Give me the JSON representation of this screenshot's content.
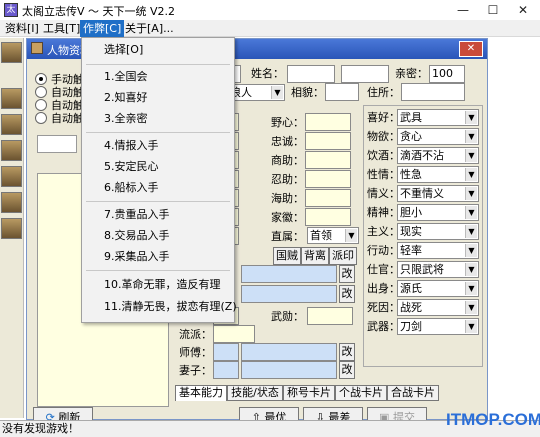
{
  "window": {
    "title": "太阁立志传V ～ 天下一统 V2.2",
    "controls": [
      "—",
      "☐",
      "✕"
    ]
  },
  "menubar": [
    "资料[I]",
    "工具[T]",
    "作弊[C]",
    "关于[A]..."
  ],
  "inner_window": {
    "title": "人物资料"
  },
  "dropdown": {
    "items": [
      {
        "label": "选择[O]"
      },
      {
        "label": "1.全国会"
      },
      {
        "label": "2.知喜好"
      },
      {
        "label": "3.全亲密"
      },
      {
        "label": "4.情报入手"
      },
      {
        "label": "5.安定民心"
      },
      {
        "label": "6.船标入手"
      },
      {
        "label": "7.贵重品入手"
      },
      {
        "label": "8.交易品入手"
      },
      {
        "label": "9.采集品入手"
      },
      {
        "label": "10.革命无罪，造反有理"
      },
      {
        "label": "11.清静无畏，拔恋有理(Z)"
      }
    ]
  },
  "radios": [
    "手动触",
    "自动触",
    "自动触",
    "自动触"
  ],
  "top_row": {
    "name_label": "姓名：",
    "affinity_label": "亲密：",
    "affinity_value": "100",
    "combo1": "浪人",
    "rank_label": "相貌：",
    "residence_label": "住所："
  },
  "stats": [
    "野心：",
    "忠诚：",
    "商助：",
    "忍助：",
    "海助：",
    "家徽："
  ],
  "direct_label": "直属：",
  "direct_value": "首领",
  "mid_buttons": [
    "国贼",
    "背离",
    "派印"
  ],
  "change_label": "改",
  "martial_label": "武勋：",
  "faction_label": "流派：",
  "master_label": "师傅：",
  "spouse_label": "妻子：",
  "right_props": [
    {
      "label": "喜好：",
      "value": "武具"
    },
    {
      "label": "物欲：",
      "value": "贪心"
    },
    {
      "label": "饮酒：",
      "value": "滴酒不沾"
    },
    {
      "label": "性情：",
      "value": "性急"
    },
    {
      "label": "情义：",
      "value": "不重情义"
    },
    {
      "label": "精神：",
      "value": "胆小"
    },
    {
      "label": "主义：",
      "value": "现实"
    },
    {
      "label": "行动：",
      "value": "轻率"
    },
    {
      "label": "仕官：",
      "value": "只限武将"
    },
    {
      "label": "出身：",
      "value": "源氏"
    },
    {
      "label": "死因：",
      "value": "战死"
    },
    {
      "label": "武器：",
      "value": "刀剑"
    }
  ],
  "tabs": [
    "基本能力",
    "技能/状态",
    "称号卡片",
    "个战卡片",
    "合战卡片"
  ],
  "bottom": {
    "refresh": "刷新",
    "best": "最优",
    "worst": "最差",
    "submit": "提交"
  },
  "status": "没有发现游戏！",
  "watermark": "ITMOP.COM"
}
